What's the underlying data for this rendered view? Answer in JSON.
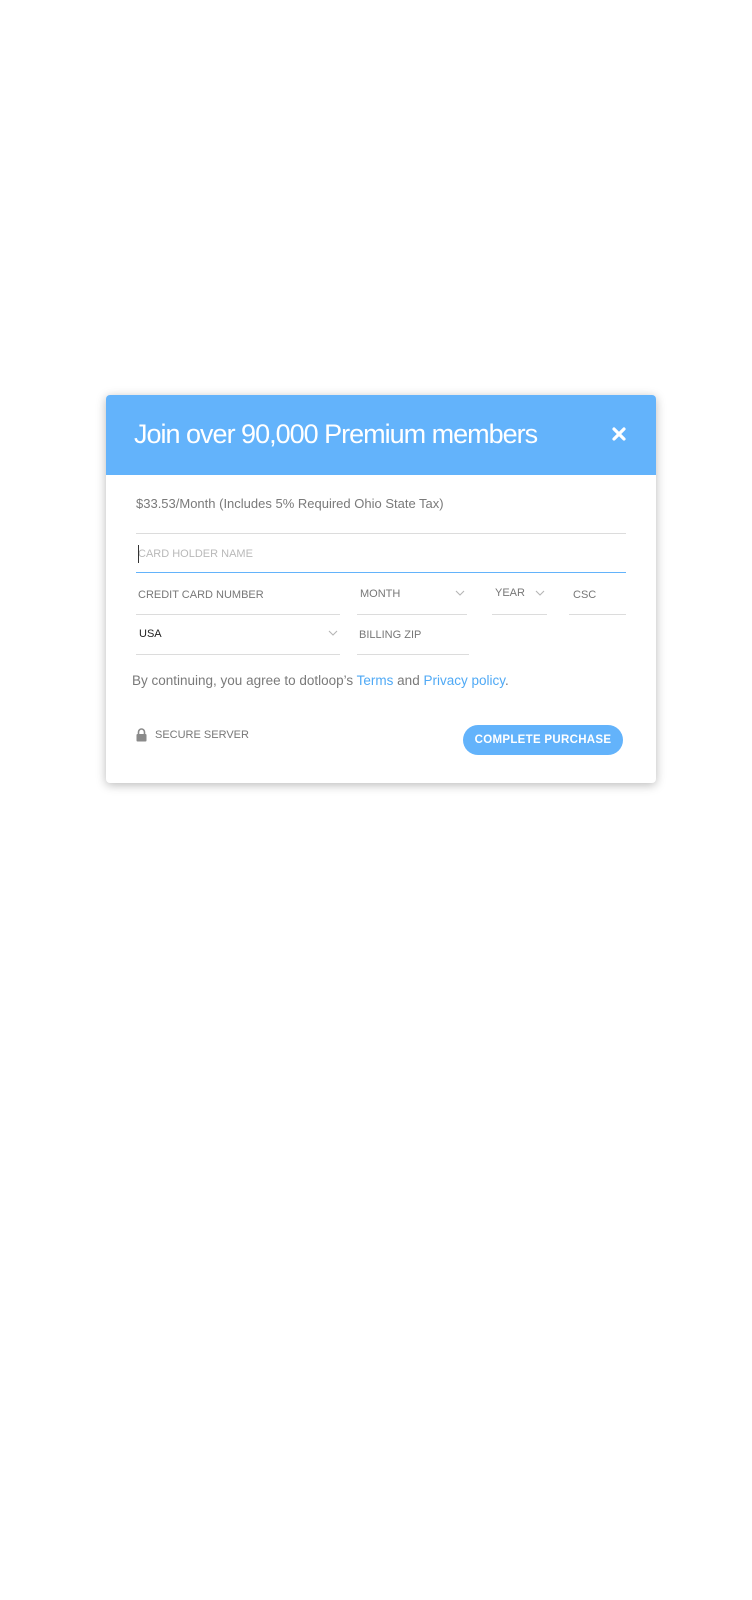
{
  "modal": {
    "title": "Join over 90,000 Premium members",
    "close_icon": "close-icon",
    "price_text": "$33.53/Month (Includes 5% Required Ohio State Tax)"
  },
  "form": {
    "card_holder_placeholder": "CARD HOLDER NAME",
    "card_number_placeholder": "CREDIT CARD NUMBER",
    "month_value": "MONTH",
    "year_value": "YEAR",
    "csc_placeholder": "CSC",
    "country_value": "USA",
    "zip_placeholder": "BILLING ZIP"
  },
  "terms": {
    "prefix": "By continuing, you agree to dotloop’s ",
    "terms_link": "Terms",
    "and": " and ",
    "privacy_link": "Privacy policy",
    "suffix": "."
  },
  "footer": {
    "secure_icon": "lock-icon",
    "secure_label": "SECURE SERVER",
    "purchase_label": "COMPLETE PURCHASE"
  },
  "colors": {
    "accent": "#63b3fb",
    "link": "#4fa9f5",
    "text_muted": "#7a7a7a"
  }
}
